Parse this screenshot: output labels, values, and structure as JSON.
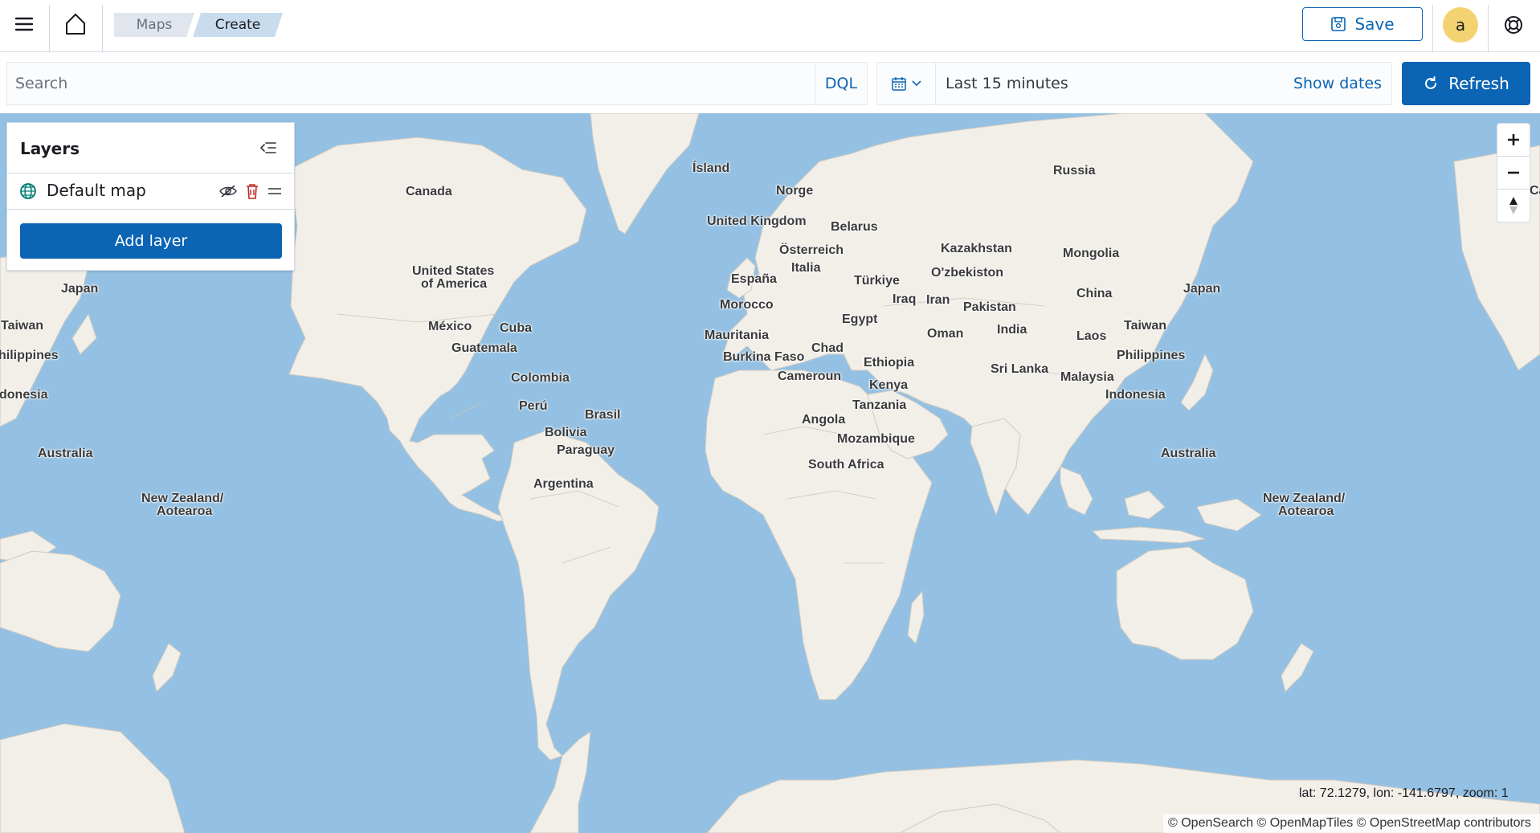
{
  "header": {
    "breadcrumbs": [
      {
        "label": "Maps"
      },
      {
        "label": "Create"
      }
    ],
    "save_label": "Save",
    "avatar_initial": "a"
  },
  "query": {
    "search_placeholder": "Search",
    "language_label": "DQL",
    "time_range": "Last 15 minutes",
    "show_dates_label": "Show dates",
    "refresh_label": "Refresh"
  },
  "layers_panel": {
    "title": "Layers",
    "layers": [
      {
        "name": "Default map"
      }
    ],
    "add_layer_label": "Add layer"
  },
  "map": {
    "labels": {
      "canada": "Canada",
      "usa_1": "United States",
      "usa_2": "of America",
      "mexico": "México",
      "cuba": "Cuba",
      "guatemala": "Guatemala",
      "colombia": "Colombia",
      "peru": "Perú",
      "brasil": "Brasil",
      "bolivia": "Bolivia",
      "paraguay": "Paraguay",
      "argentina": "Argentina",
      "island": "Ísland",
      "norge": "Norge",
      "uk": "United Kingdom",
      "belarus": "Belarus",
      "osterreich": "Österreich",
      "italia": "Italia",
      "espana": "España",
      "turkiye": "Türkiye",
      "morocco": "Morocco",
      "egypt": "Egypt",
      "iraq": "Iraq",
      "iran": "Iran",
      "mauritania": "Mauritania",
      "burkina": "Burkina Faso",
      "chad": "Chad",
      "ethiopia": "Ethiopia",
      "cameroun": "Cameroun",
      "kenya": "Kenya",
      "tanzania": "Tanzania",
      "angola": "Angola",
      "mozambique": "Mozambique",
      "south_africa": "South Africa",
      "russia": "Russia",
      "kazakhstan": "Kazakhstan",
      "mongolia": "Mongolia",
      "uzbekistan": "O'zbekiston",
      "pakistan": "Pakistan",
      "china": "China",
      "oman": "Oman",
      "india": "India",
      "laos": "Laos",
      "taiwan_e": "Taiwan",
      "japan_e": "Japan",
      "sri_lanka": "Sri Lanka",
      "malaysia": "Malaysia",
      "philippines_e": "Philippines",
      "indonesia_e": "Indonesia",
      "australia_e": "Australia",
      "nz_e_1": "New Zealand/",
      "nz_e_2": "Aotearoa",
      "japan_w": "Japan",
      "taiwan_w": "Taiwan",
      "philippines_w": "hilippines",
      "indonesia_w": "donesia",
      "australia_w": "Australia",
      "nz_w_1": "New Zealand/",
      "nz_w_2": "Aotearoa",
      "canada_cut": "Ca"
    },
    "colors": {
      "water": "#94c1e3",
      "land": "#f2efe9",
      "border": "#c8c4bb"
    },
    "coords_readout": "lat: 72.1279, lon: -141.6797, zoom: 1",
    "attribution": "© OpenSearch © OpenMapTiles © OpenStreetMap contributors"
  }
}
